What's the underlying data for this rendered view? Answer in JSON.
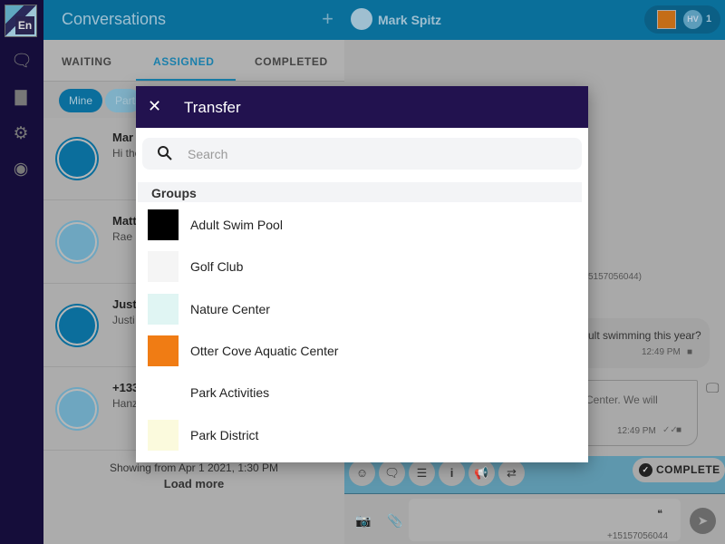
{
  "sidebar": {
    "logo_text": "En",
    "icons": [
      "chat-icon",
      "chart-icon",
      "gear-icon",
      "user-icon"
    ]
  },
  "left": {
    "title": "Conversations",
    "tabs": [
      "WAITING",
      "ASSIGNED",
      "COMPLETED"
    ],
    "active_tab": "ASSIGNED",
    "chips": [
      "Mine",
      "Parti"
    ],
    "conversations": [
      {
        "name": "Mar",
        "snippet": "Hi the"
      },
      {
        "name": "Matt",
        "snippet": "Rae ."
      },
      {
        "name": "Just",
        "snippet": "Justi"
      },
      {
        "name": "+133",
        "snippet": "Hanz"
      }
    ],
    "showing": "Showing from Apr 1 2021, 1:30 PM",
    "load_more": "Load more"
  },
  "right": {
    "contact": "Mark Spitz",
    "agent_initials": "HV",
    "agent_count": "1",
    "messages": {
      "phone_partial": "5157056044)",
      "msg1": "ult swimming this year?",
      "time1": "12:49 PM",
      "msg2": "Center.  We will",
      "time2": "12:49 PM"
    },
    "complete_label": "COMPLETE",
    "from_number": "+15157056044"
  },
  "modal": {
    "title": "Transfer",
    "search_placeholder": "Search",
    "section": "Groups",
    "groups": [
      {
        "name": "Adult Swim Pool",
        "logo": "LOGO",
        "color": "#000000"
      },
      {
        "name": "Golf Club",
        "logo": "Golf Club",
        "color": "#f5f5f5"
      },
      {
        "name": "Nature Center",
        "logo": "Nature",
        "color": "#e0f5f3"
      },
      {
        "name": "Otter Cove Aquatic Center",
        "logo": "",
        "color": "#f07c14"
      },
      {
        "name": "Park Activities",
        "logo": "Park Activities",
        "color": "#ffffff"
      },
      {
        "name": "Park District",
        "logo": "Park District",
        "color": "#fbfadd"
      }
    ]
  },
  "colors": {
    "header": "#0a6f9a",
    "sidebar": "#150d3a",
    "modal_header": "#22124f"
  }
}
